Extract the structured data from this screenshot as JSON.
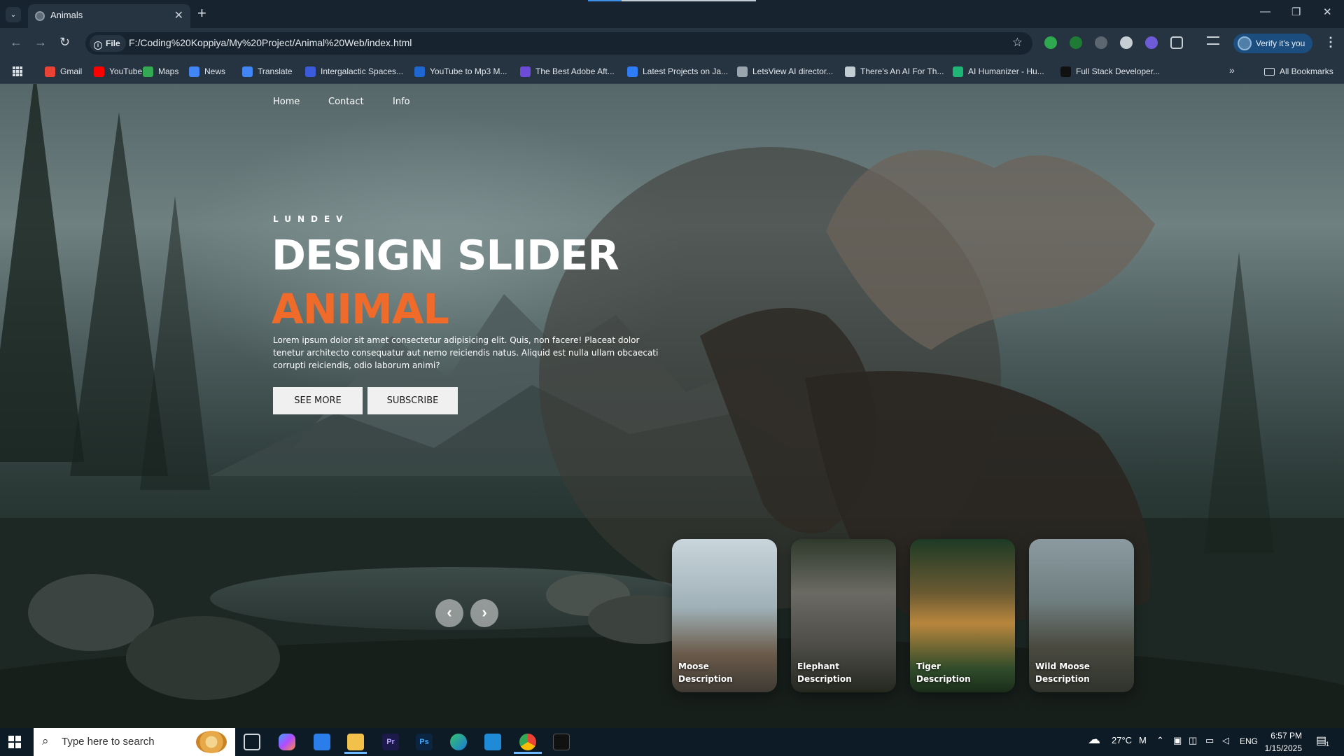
{
  "browser": {
    "tab_title": "Animals",
    "site_chip": "File",
    "url": "F:/Coding%20Koppiya/My%20Project/Animal%20Web/index.html",
    "verify_label": "Verify it's you",
    "bookmarks": [
      {
        "label": "Gmail",
        "color": "#ea4335"
      },
      {
        "label": "YouTube",
        "color": "#ff0000"
      },
      {
        "label": "Maps",
        "color": "#34a853"
      },
      {
        "label": "News",
        "color": "#4285f4"
      },
      {
        "label": "Translate",
        "color": "#4285f4"
      },
      {
        "label": "Intergalactic Spaces...",
        "color": "#3b5bdb"
      },
      {
        "label": "YouTube to Mp3 M...",
        "color": "#1e66d0"
      },
      {
        "label": "The Best Adobe Aft...",
        "color": "#6b4bd8"
      },
      {
        "label": "Latest Projects on Ja...",
        "color": "#2f7df6"
      },
      {
        "label": "LetsView AI director...",
        "color": "#9aa4ad"
      },
      {
        "label": "There's An AI For Th...",
        "color": "#c4ccd3"
      },
      {
        "label": "AI Humanizer - Hu...",
        "color": "#1fb574"
      },
      {
        "label": "Full Stack Developer...",
        "color": "#111111"
      }
    ],
    "all_bookmarks": "All Bookmarks",
    "more_chevron": "»"
  },
  "page": {
    "nav": [
      "Home",
      "Contact",
      "Info"
    ],
    "brand": "LUNDEV",
    "title": "DESIGN SLIDER",
    "topic": "ANIMAL",
    "description": "Lorem ipsum dolor sit amet consectetur adipisicing elit. Quis, non facere! Placeat dolor tenetur architecto consequatur aut nemo reiciendis natus. Aliquid est nulla ullam obcaecati corrupti reiciendis, odio laborum animi?",
    "buttons": {
      "see_more": "SEE MORE",
      "subscribe": "SUBSCRIBE"
    },
    "arrows": {
      "prev": "‹",
      "next": "›"
    },
    "accent_color": "#f06a2a",
    "thumbnails": [
      {
        "title": "Moose",
        "subtitle": "Description"
      },
      {
        "title": "Elephant",
        "subtitle": "Description"
      },
      {
        "title": "Tiger",
        "subtitle": "Description"
      },
      {
        "title": "Wild Moose",
        "subtitle": "Description"
      }
    ]
  },
  "taskbar": {
    "search_placeholder": "Type here to search",
    "weather": "27°C",
    "weather_suffix": "M",
    "language": "ENG",
    "time": "6:57 PM",
    "date": "1/15/2025",
    "notifications": "1",
    "apps": [
      "task-view",
      "copilot",
      "store",
      "file-explorer",
      "premiere-pro",
      "photoshop",
      "edge",
      "vscode",
      "chrome",
      "terminal"
    ]
  }
}
